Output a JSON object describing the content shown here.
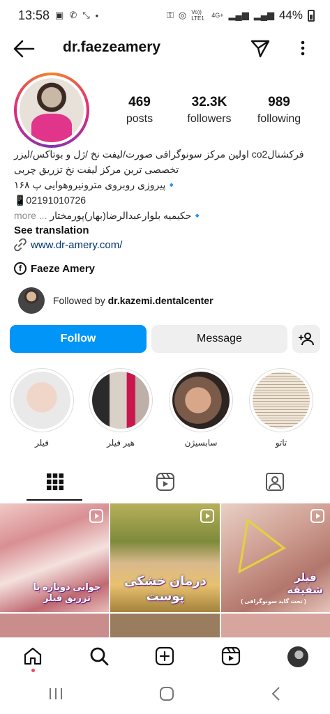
{
  "status_bar": {
    "time": "13:58",
    "network": "Vo)) LTE1",
    "signal": "4G+",
    "battery": "44%"
  },
  "header": {
    "username": "dr.faezeamery"
  },
  "stats": [
    {
      "value": "469",
      "label": "posts"
    },
    {
      "value": "32.3K",
      "label": "followers"
    },
    {
      "value": "989",
      "label": "following"
    }
  ],
  "bio": {
    "line1": "فرکشنالco2 اولین مرکز سونوگرافی صورت/لیفت نخ /ژل و بوتاکس/لیزر",
    "line2": "تخصصی ترین مرکز لیفت نخ تزریق چربی",
    "line3": "🔹پیروزی روبروی مترونیروهوایی پ ۱۶۸",
    "line4": "📱02191010726",
    "line5": "🔹حکیمیه بلوارعبدالرضا(بهار)پورمختار",
    "more": "... more",
    "see_translation": "See translation",
    "website": "www.dr-amery.com/",
    "facebook": "Faeze Amery"
  },
  "followed_by": {
    "prefix": "Followed by",
    "user": "dr.kazemi.dentalcenter"
  },
  "buttons": {
    "follow": "Follow",
    "message": "Message"
  },
  "highlights": [
    {
      "label": "فیلر"
    },
    {
      "label": "هیر فیلر"
    },
    {
      "label": "سابسیژن"
    },
    {
      "label": "تاتو"
    }
  ],
  "posts": [
    {
      "caption": "جوانی دوباره با تزریق فیلر"
    },
    {
      "caption": "درمان خشکی پوست"
    },
    {
      "caption": "فیلر شقیقه",
      "sub": "( تحت گاید سونوگرافی )"
    }
  ],
  "colors": {
    "follow_button": "#0095f6",
    "link": "#00376b",
    "notification_dot": "#ed4956"
  }
}
